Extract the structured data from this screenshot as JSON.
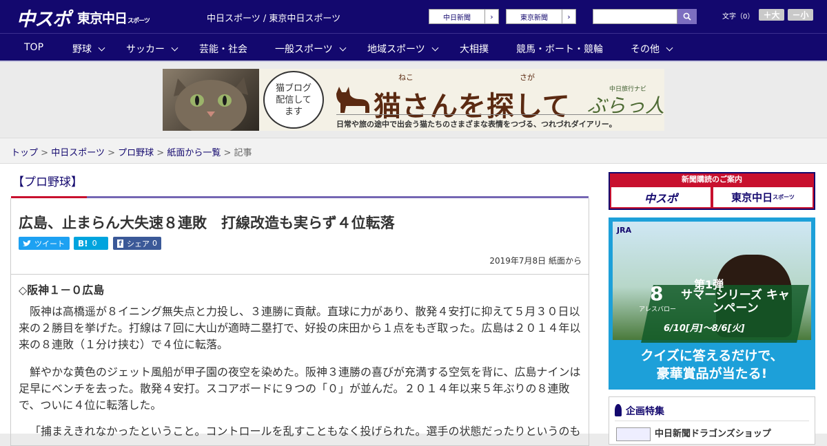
{
  "header": {
    "logo_main": "中スポ",
    "logo_sub": "東京中日",
    "logo_sub_small": "スポーツ",
    "tagline": "中日スポーツ / 東京中日スポーツ",
    "site_buttons": [
      {
        "label": "中日新聞",
        "arrow": "›"
      },
      {
        "label": "東京新聞",
        "arrow": "›"
      }
    ],
    "search": {
      "placeholder": ""
    },
    "font_size": {
      "label": "文字（0）",
      "larger": "＋大",
      "smaller": "－小"
    }
  },
  "nav": {
    "items": [
      {
        "label": "TOP",
        "has_dropdown": false
      },
      {
        "label": "野球",
        "has_dropdown": true
      },
      {
        "label": "サッカー",
        "has_dropdown": true
      },
      {
        "label": "芸能・社会",
        "has_dropdown": false
      },
      {
        "label": "一般スポーツ",
        "has_dropdown": true
      },
      {
        "label": "地域スポーツ",
        "has_dropdown": true
      },
      {
        "label": "大相撲",
        "has_dropdown": false
      },
      {
        "label": "競馬・ボート・競輪",
        "has_dropdown": false
      },
      {
        "label": "その他",
        "has_dropdown": true
      }
    ]
  },
  "banner": {
    "bubble_lines": [
      "猫ブログ",
      "配信して",
      "ます"
    ],
    "title": "猫さんを探して",
    "ruby": [
      "ねこ",
      "さが"
    ],
    "brand_small": "中日旅行ナビ",
    "brand": "ぶらっ人",
    "caption": "日常や旅の途中で出会う猫たちのさまざまな表情をつづる、つれづれダイアリー。"
  },
  "breadcrumb": {
    "items": [
      {
        "label": "トップ",
        "link": true
      },
      {
        "label": "中日スポーツ",
        "link": true
      },
      {
        "label": "プロ野球",
        "link": true
      },
      {
        "label": "紙面から一覧",
        "link": true
      },
      {
        "label": "記事",
        "link": false
      }
    ],
    "separator": ">"
  },
  "article": {
    "category": "【プロ野球】",
    "headline": "広島、止まらん大失速８連敗　打線改造も実らず４位転落",
    "share": {
      "twitter": "ツイート",
      "hatena_count": "0",
      "facebook": "シェア",
      "facebook_count": "0"
    },
    "dateline": "2019年7月8日 紙面から",
    "subhead": "◇阪神１－０広島",
    "paragraphs": [
      "阪神は高橋遥が８イニング無失点と力投し、３連勝に貢献。直球に力があり、散発４安打に抑えて５月３０日以来の２勝目を挙げた。打線は７回に大山が適時二塁打で、好投の床田から１点をもぎ取った。広島は２０１４年以来の８連敗（１分け挟む）で４位に転落。",
      "鮮やかな黄色のジェット風船が甲子園の夜空を染めた。阪神３連勝の喜びが充満する空気を背に、広島ナインは足早にベンチを去った。散発４安打。スコアボードに９つの「０」が並んだ。２０１４年以来５年ぶりの８連敗で、ついに４位に転落した。",
      "「捕まえきれなかったということ。コントロールを乱すこともなく投げられた。選手の状態だったりというのも"
    ]
  },
  "sidebar": {
    "promo": {
      "title": "新聞購読のご案内",
      "btn1": "中スポ",
      "btn2": "東京中日",
      "btn2_small": "スポーツ"
    },
    "jra": {
      "logo": "JRA",
      "round": "第1弾",
      "number": "8",
      "horse_name": "アレスバロー",
      "campaign": "サマーシリーズ キャンペーン",
      "dates": "6/10[月]～8/6[火]",
      "cta_line1": "クイズに答えるだけで、",
      "cta_line2": "豪華賞品が当たる!"
    },
    "kikaku": {
      "title": "企画特集",
      "item": "中日新聞ドラゴンズショップ"
    }
  }
}
